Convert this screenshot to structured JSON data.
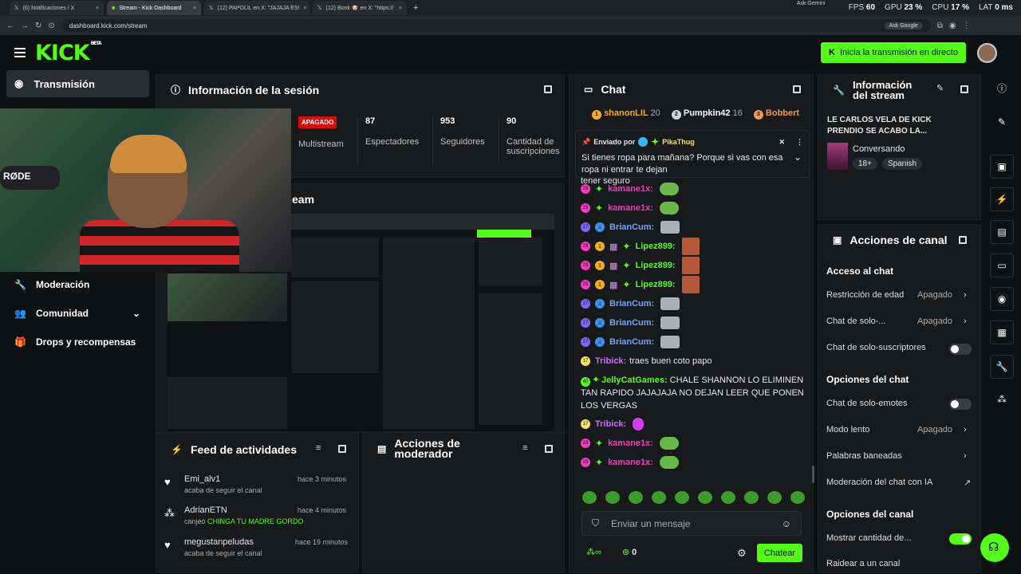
{
  "browser": {
    "tabs": [
      {
        "label": "(6) Notificaciones / X",
        "icon": "x-icon"
      },
      {
        "label": "Stream - Kick Dashboard",
        "icon": "kick-icon",
        "active": true
      },
      {
        "label": "(12) PAPOLIL en X: \"JAJAJA ES!",
        "icon": "x-icon"
      },
      {
        "label": "(12) Bonk 🐶 en X: \"https://",
        "icon": "x-icon"
      }
    ],
    "perf": {
      "fps_label": "FPS",
      "fps": "60",
      "gpu_label": "GPU",
      "gpu": "23 %",
      "cpu_label": "CPU",
      "cpu": "17 %",
      "lat_label": "LAT",
      "lat": "0 ms"
    },
    "url": "dashboard.kick.com/stream",
    "ask_google": "Ask Google",
    "ask_gemini": "Ask Gemini"
  },
  "header": {
    "logo": "KICK",
    "logo_beta": "BETA",
    "go_live": "Inicia la transmisión en directo"
  },
  "leftnav": {
    "active": "Transmisión",
    "items": [
      {
        "label": "Moderación",
        "icon": "wrench-icon"
      },
      {
        "label": "Comunidad",
        "icon": "users-icon"
      },
      {
        "label": "Drops y recompensas",
        "icon": "gift-icon"
      }
    ]
  },
  "session": {
    "title": "Información de la sesión",
    "status": "APAGADO",
    "multistream": "Multistream",
    "stats": [
      {
        "value": "87",
        "label": "Espectadores"
      },
      {
        "value": "953",
        "label": "Seguidores"
      },
      {
        "value": "90",
        "label": "Cantidad de suscripciones"
      }
    ]
  },
  "stream_preview": {
    "title_fragment": "eam"
  },
  "feed": {
    "title": "Feed de actividades",
    "items": [
      {
        "name": "Emi_alv1",
        "sub": "acaba de seguir el canal",
        "time": "hace 3 minutos",
        "icon": "heart-icon"
      },
      {
        "name": "AdrianETN",
        "sub_prefix": "canjeó",
        "sub_highlight": "CHINGA TU MADRE GORDO",
        "time": "hace 4 minutos",
        "icon": "kick-coins-icon"
      },
      {
        "name": "megustanpeludas",
        "sub": "acaba de seguir el canal",
        "time": "hace 19 minutos",
        "icon": "heart-icon"
      }
    ]
  },
  "mod_actions": {
    "title": "Acciones de moderador"
  },
  "chat": {
    "title": "Chat",
    "leaderboard": [
      {
        "name": "shanonLIL",
        "value": "20",
        "color": "#f4ad1a"
      },
      {
        "name": "Pumpkin42",
        "value": "16",
        "color": "#cfd2d6"
      },
      {
        "name": "Bobbert",
        "value": "",
        "color": "#f19a4a"
      }
    ],
    "pinned": {
      "label": "Enviado por",
      "user": "PikaThug",
      "text": "Si tienes ropa para mañana? Porque si vas con esa ropa ni entrar te dejan"
    },
    "partial_line": "tener seguro",
    "messages": [
      {
        "user": "kamane1x",
        "color": "#f03ac0",
        "badges": [
          "23",
          "star"
        ],
        "emote": "frog",
        "text": ""
      },
      {
        "user": "kamane1x",
        "color": "#f03ac0",
        "badges": [
          "23",
          "star"
        ],
        "emote": "frog",
        "text": ""
      },
      {
        "user": "BrianCum",
        "color": "#6ea8ff",
        "badges": [
          "27",
          "mod"
        ],
        "emote": "skel",
        "text": ""
      },
      {
        "user": "Lipez899",
        "color": "#53fc18",
        "badges": [
          "23",
          "1",
          "gift",
          "star"
        ],
        "emote": "mon",
        "text": ""
      },
      {
        "user": "Lipez899",
        "color": "#53fc18",
        "badges": [
          "23",
          "1",
          "gift",
          "star"
        ],
        "emote": "mon",
        "text": ""
      },
      {
        "user": "Lipez899",
        "color": "#53fc18",
        "badges": [
          "23",
          "1",
          "gift",
          "star"
        ],
        "emote": "mon",
        "text": ""
      },
      {
        "user": "BrianCum",
        "color": "#6ea8ff",
        "badges": [
          "27",
          "mod"
        ],
        "emote": "skel",
        "text": ""
      },
      {
        "user": "BrianCum",
        "color": "#6ea8ff",
        "badges": [
          "27",
          "mod"
        ],
        "emote": "skel",
        "text": ""
      },
      {
        "user": "BrianCum",
        "color": "#6ea8ff",
        "badges": [
          "27",
          "mod"
        ],
        "emote": "skel",
        "text": ""
      },
      {
        "user": "Tribick",
        "color": "#d06aff",
        "badges": [
          "17"
        ],
        "emote": "",
        "text": "traes buen coto papo"
      },
      {
        "user": "JellyCatGames",
        "color": "#53fc18",
        "badges": [
          "40",
          "star"
        ],
        "emote": "",
        "text": "CHALE SHANNON LO ELIMINEN TAN RAPIDO JAJAJAJA NO DEJAN LEER QUE PONEN LOS VERGAS"
      },
      {
        "user": "Tribick",
        "color": "#d06aff",
        "badges": [
          "17"
        ],
        "emote": "pink",
        "text": ""
      },
      {
        "user": "kamane1x",
        "color": "#f03ac0",
        "badges": [
          "23",
          "star"
        ],
        "emote": "frog",
        "text": ""
      },
      {
        "user": "kamane1x",
        "color": "#f03ac0",
        "badges": [
          "23",
          "star"
        ],
        "emote": "frog",
        "text": ""
      }
    ],
    "input_placeholder": "Enviar un mensaje",
    "viewer_count": "0",
    "send_label": "Chatear"
  },
  "stream_info": {
    "title": "Información del stream",
    "stream_title": "LE CARLOS VELA DE KICK PRENDIO SE ACABO LA...",
    "category": "Conversando",
    "tags": [
      "18+",
      "Spanish"
    ]
  },
  "channel_actions": {
    "title": "Acciones de canal",
    "chat_access": {
      "heading": "Acceso al chat",
      "rows": [
        {
          "label": "Restricción de edad",
          "value": "Apagado"
        },
        {
          "label": "Chat de solo-...",
          "value": "Apagado"
        },
        {
          "label": "Chat de solo-suscriptores",
          "toggle": false
        }
      ]
    },
    "chat_options": {
      "heading": "Opciones del chat",
      "rows": [
        {
          "label": "Chat de solo-emotes",
          "toggle": false
        },
        {
          "label": "Modo lento",
          "value": "Apagado"
        },
        {
          "label": "Palabras baneadas",
          "value": ""
        },
        {
          "label": "Moderación del chat con IA",
          "value": ""
        }
      ]
    },
    "channel_options": {
      "heading": "Opciones del canal",
      "rows": [
        {
          "label": "Mostrar cantidad de...",
          "toggle": true
        },
        {
          "label": "Raidear a un canal"
        }
      ]
    }
  },
  "colors": {
    "accent": "#53fc18",
    "offline": "#d40c0c",
    "panel": "#18191b"
  }
}
